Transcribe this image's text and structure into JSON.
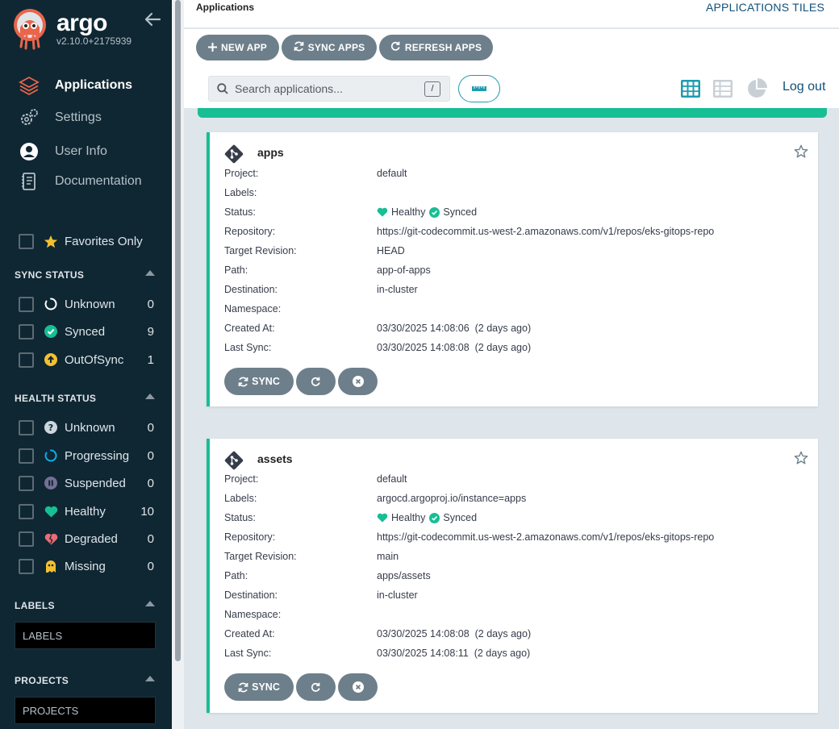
{
  "sidebar": {
    "brand": "argo",
    "version": "v2.10.0+2175939",
    "nav": [
      {
        "label": "Applications",
        "icon": "layers-icon",
        "active": true
      },
      {
        "label": "Settings",
        "icon": "gears-icon"
      },
      {
        "label": "User Info",
        "icon": "user-circle-icon"
      },
      {
        "label": "Documentation",
        "icon": "book-icon"
      }
    ],
    "favorites_label": "Favorites Only",
    "sync_status": {
      "title": "SYNC STATUS",
      "items": [
        {
          "label": "Unknown",
          "count": "0",
          "icon": "circle-notch-icon",
          "color": "#ffffff"
        },
        {
          "label": "Synced",
          "count": "9",
          "icon": "check-circle-icon",
          "color": "#18be94"
        },
        {
          "label": "OutOfSync",
          "count": "1",
          "icon": "arrow-circle-up-icon",
          "color": "#f4c030"
        }
      ]
    },
    "health_status": {
      "title": "HEALTH STATUS",
      "items": [
        {
          "label": "Unknown",
          "count": "0",
          "icon": "question-circle-icon",
          "color": "#ccd6dd"
        },
        {
          "label": "Progressing",
          "count": "0",
          "icon": "circle-notch-icon",
          "color": "#0dadea"
        },
        {
          "label": "Suspended",
          "count": "0",
          "icon": "pause-circle-icon",
          "color": "#766f94"
        },
        {
          "label": "Healthy",
          "count": "10",
          "icon": "heart-icon",
          "color": "#18be94"
        },
        {
          "label": "Degraded",
          "count": "0",
          "icon": "heart-broken-icon",
          "color": "#e96d76"
        },
        {
          "label": "Missing",
          "count": "0",
          "icon": "ghost-icon",
          "color": "#f4c030"
        }
      ]
    },
    "labels": {
      "title": "LABELS",
      "placeholder": "LABELS"
    },
    "projects": {
      "title": "PROJECTS",
      "placeholder": "PROJECTS"
    }
  },
  "header": {
    "breadcrumb": "Applications",
    "view_title": "APPLICATIONS TILES"
  },
  "toolbar": {
    "new_app": "NEW APP",
    "sync_apps": "SYNC APPS",
    "refresh_apps": "REFRESH APPS",
    "search_placeholder": "Search applications...",
    "search_shortcut": "/",
    "logout": "Log out"
  },
  "row_labels": {
    "project": "Project:",
    "labels": "Labels:",
    "status": "Status:",
    "repository": "Repository:",
    "target_revision": "Target Revision:",
    "path": "Path:",
    "destination": "Destination:",
    "namespace": "Namespace:",
    "created_at": "Created At:",
    "last_sync": "Last Sync:"
  },
  "apps": [
    {
      "name": "apps",
      "project": "default",
      "labels": "",
      "health": "Healthy",
      "sync": "Synced",
      "repository": "https://git-codecommit.us-west-2.amazonaws.com/v1/repos/eks-gitops-repo",
      "target_revision": "HEAD",
      "path": "app-of-apps",
      "destination": "in-cluster",
      "namespace": "",
      "created_at": "03/30/2025 14:08:06  (2 days ago)",
      "last_sync": "03/30/2025 14:08:08  (2 days ago)",
      "sync_button": "SYNC"
    },
    {
      "name": "assets",
      "project": "default",
      "labels": "argocd.argoproj.io/instance=apps",
      "health": "Healthy",
      "sync": "Synced",
      "repository": "https://git-codecommit.us-west-2.amazonaws.com/v1/repos/eks-gitops-repo",
      "target_revision": "main",
      "path": "apps/assets",
      "destination": "in-cluster",
      "namespace": "",
      "created_at": "03/30/2025 14:08:08  (2 days ago)",
      "last_sync": "03/30/2025 14:08:11  (2 days ago)",
      "sync_button": "SYNC"
    }
  ],
  "colors": {
    "sidebar_bg": "#0f2733",
    "accent_green": "#18be94",
    "button_gray": "#6d7f8b",
    "link_blue": "#13507b",
    "teal": "#1d9bb0"
  }
}
